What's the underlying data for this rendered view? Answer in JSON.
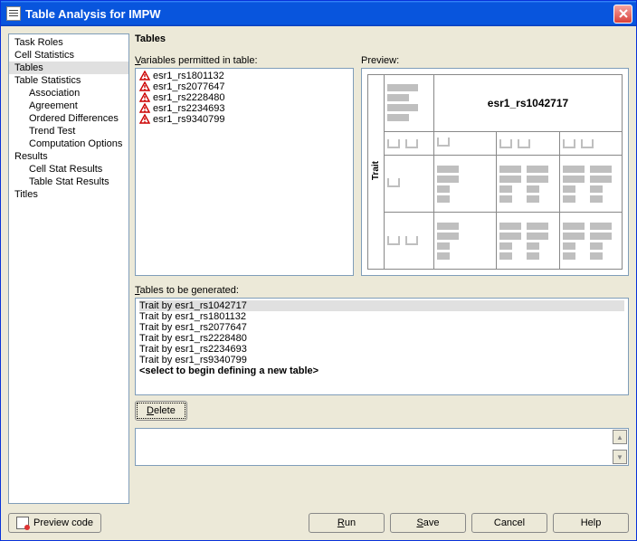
{
  "window": {
    "title": "Table Analysis for IMPW"
  },
  "nav": {
    "items": [
      {
        "label": "Task Roles",
        "indent": 0,
        "selected": false
      },
      {
        "label": "Cell Statistics",
        "indent": 0,
        "selected": false
      },
      {
        "label": "Tables",
        "indent": 0,
        "selected": true
      },
      {
        "label": "Table Statistics",
        "indent": 0,
        "selected": false
      },
      {
        "label": "Association",
        "indent": 1,
        "selected": false
      },
      {
        "label": "Agreement",
        "indent": 1,
        "selected": false
      },
      {
        "label": "Ordered Differences",
        "indent": 1,
        "selected": false
      },
      {
        "label": "Trend Test",
        "indent": 1,
        "selected": false
      },
      {
        "label": "Computation Options",
        "indent": 1,
        "selected": false
      },
      {
        "label": "Results",
        "indent": 0,
        "selected": false
      },
      {
        "label": "Cell Stat Results",
        "indent": 1,
        "selected": false
      },
      {
        "label": "Table Stat Results",
        "indent": 1,
        "selected": false
      },
      {
        "label": "Titles",
        "indent": 0,
        "selected": false
      }
    ]
  },
  "content": {
    "heading": "Tables",
    "vars_label": "Variables permitted in table:",
    "variables": [
      "esr1_rs1801132",
      "esr1_rs2077647",
      "esr1_rs2228480",
      "esr1_rs2234693",
      "esr1_rs9340799"
    ],
    "preview_label": "Preview:",
    "preview": {
      "column_header": "esr1_rs1042717",
      "row_header": "Trait"
    },
    "tables_label": "Tables to be generated:",
    "tables": [
      {
        "label": "Trait by esr1_rs1042717",
        "selected": true
      },
      {
        "label": "Trait by esr1_rs1801132",
        "selected": false
      },
      {
        "label": "Trait by esr1_rs2077647",
        "selected": false
      },
      {
        "label": "Trait by esr1_rs2228480",
        "selected": false
      },
      {
        "label": "Trait by esr1_rs2234693",
        "selected": false
      },
      {
        "label": "Trait by esr1_rs9340799",
        "selected": false
      }
    ],
    "tables_placeholder": "<select to begin defining a new table>",
    "delete_label": "Delete"
  },
  "footer": {
    "preview_code": "Preview code",
    "run": "Run",
    "save": "Save",
    "cancel": "Cancel",
    "help": "Help"
  }
}
